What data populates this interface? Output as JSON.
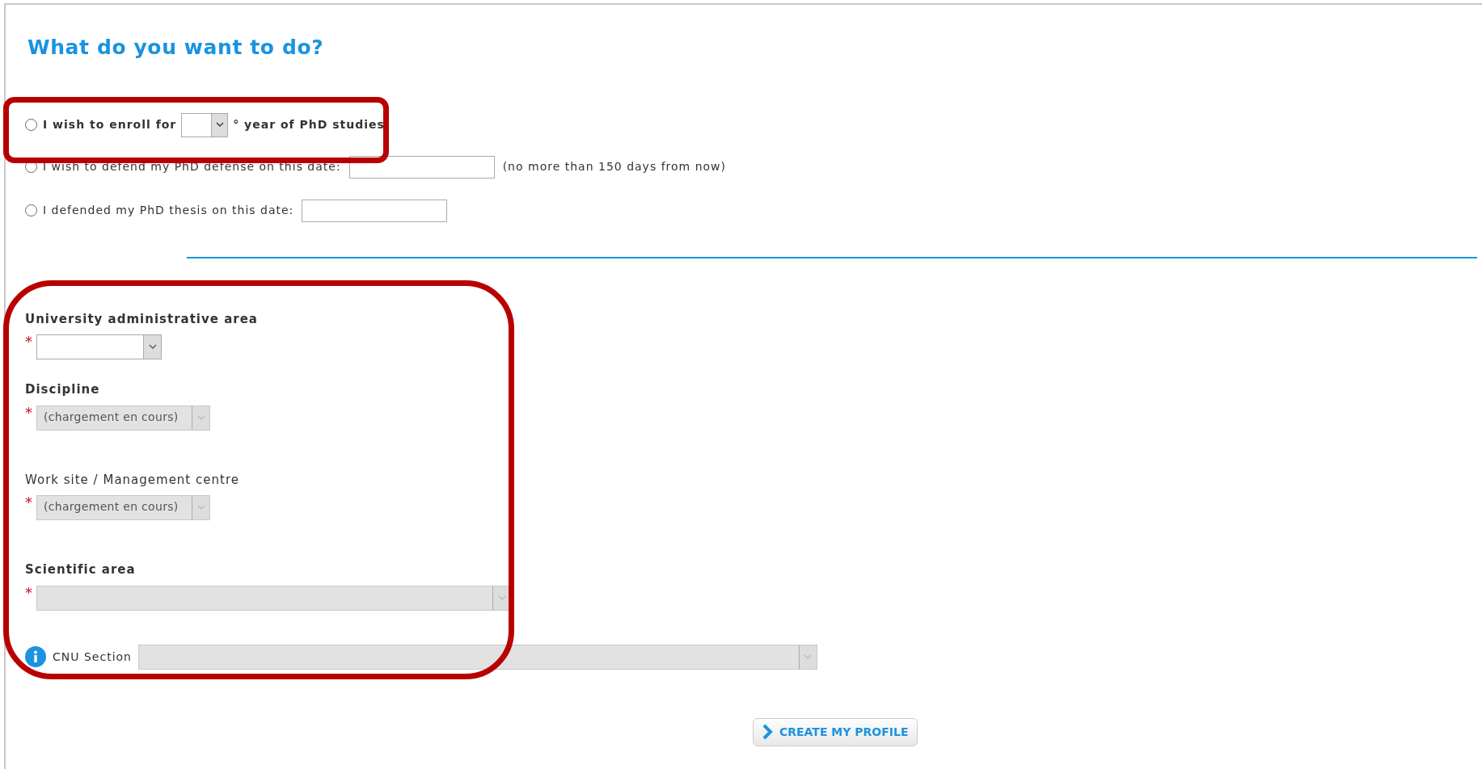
{
  "heading": "What do you want to do?",
  "options": [
    {
      "kind": "year",
      "selected": false,
      "label": "I wish to enroll for",
      "suffix": "° year of PhD studies"
    },
    {
      "kind": "date",
      "selected": false,
      "label": "I wish to defend my PhD defense on this date:",
      "note": "(no more than 150 days from now)"
    },
    {
      "kind": "date",
      "selected": false,
      "label": "I defended my PhD thesis on this date:"
    }
  ],
  "fields": [
    {
      "kind": "short",
      "label": "University administrative area",
      "bold": true,
      "required_mark": "*",
      "disabled": false
    },
    {
      "kind": "medium",
      "label": "Discipline",
      "bold": true,
      "required_mark": "*",
      "disabled": true,
      "value": "(chargement en cours)"
    },
    {
      "kind": "medium",
      "label": "Work site / Management centre",
      "bold": false,
      "required_mark": "*",
      "disabled": true,
      "value": "(chargement en cours)"
    },
    {
      "kind": "wide",
      "label": "Scientific area",
      "bold": true,
      "required_mark": "*",
      "disabled": true
    }
  ],
  "cnu": {
    "label": "CNU Section",
    "disabled": true
  },
  "submit": {
    "label": "CREATE MY PROFILE"
  }
}
